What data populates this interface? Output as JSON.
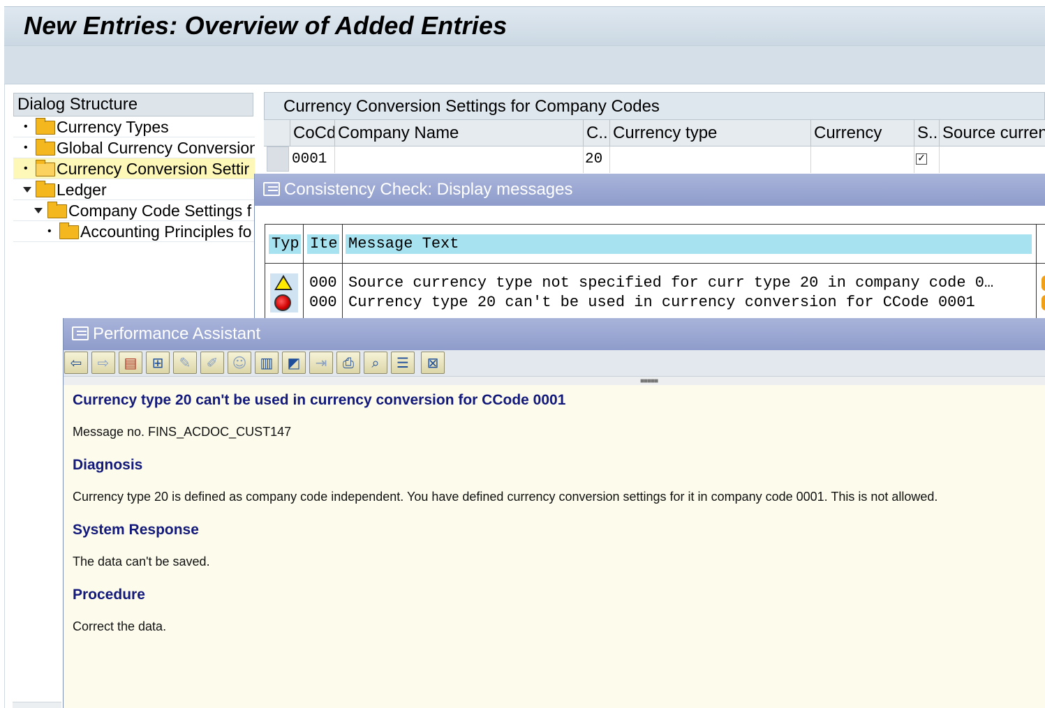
{
  "header": {
    "title": "New Entries: Overview of Added Entries"
  },
  "dialog_structure": {
    "title": "Dialog Structure",
    "items": [
      {
        "label": "Currency Types"
      },
      {
        "label": "Global Currency Conversion"
      },
      {
        "label": "Currency Conversion Settir"
      },
      {
        "label": "Ledger"
      },
      {
        "label": "Company Code Settings f"
      },
      {
        "label": "Accounting Principles fo"
      }
    ]
  },
  "table": {
    "title": "Currency Conversion Settings for Company Codes",
    "columns": [
      "CoCd",
      "Company Name",
      "C..",
      "Currency type",
      "Currency",
      "S..",
      "Source curren"
    ],
    "row": {
      "cocd": "0001",
      "company_name": "",
      "c": "20",
      "currency_type": "",
      "currency": "",
      "s_checked": true,
      "source_currency": ""
    }
  },
  "consistency_dialog": {
    "title": "Consistency Check: Display messages",
    "columns": [
      "Typ",
      "Ite",
      "Message Text"
    ],
    "rows": [
      {
        "type_icon": "warning-icon",
        "item": "000",
        "text": "Source currency type not specified for curr type 20 in company code 0…"
      },
      {
        "type_icon": "error-icon",
        "item": "000",
        "text": "Currency type 20 can't be used in currency conversion for CCode 0001"
      }
    ]
  },
  "performance_assistant": {
    "title": "Performance Assistant",
    "toolbar_icons": [
      "back-arrow-icon",
      "forward-arrow-icon",
      "document-icon",
      "tree-structure-icon",
      "edit-icon",
      "edit-pencil-icon",
      "user-icon",
      "display-icon",
      "technical-info-icon",
      "forward-doc-icon",
      "print-icon",
      "find-icon",
      "long-text-icon",
      "close-window-icon"
    ],
    "heading": "Currency type 20 can't be used in currency conversion for CCode 0001",
    "message_no": "Message no. FINS_ACDOC_CUST147",
    "diagnosis_title": "Diagnosis",
    "diagnosis_text": "Currency type 20 is defined as company code independent. You have defined currency conversion settings for it in company code 0001. This is not allowed.",
    "system_response_title": "System Response",
    "system_response_text": "The data can't be saved.",
    "procedure_title": "Procedure",
    "procedure_text": "Correct the data."
  },
  "colors": {
    "dialog_title_bg": "#8e9ccb",
    "help_heading": "#12197a",
    "help_bg": "#fdfcec",
    "selected_row": "#fdf8b8",
    "message_header_bg": "#a7e2f0"
  }
}
